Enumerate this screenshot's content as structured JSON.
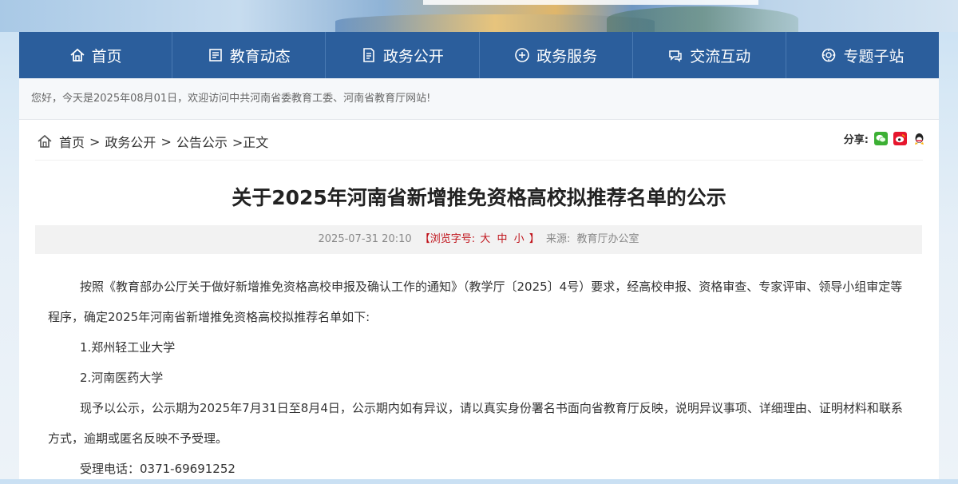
{
  "nav": {
    "items": [
      {
        "label": "首页",
        "icon": "home-icon"
      },
      {
        "label": "教育动态",
        "icon": "news-icon"
      },
      {
        "label": "政务公开",
        "icon": "document-icon"
      },
      {
        "label": "政务服务",
        "icon": "service-icon"
      },
      {
        "label": "交流互动",
        "icon": "interaction-icon"
      },
      {
        "label": "专题子站",
        "icon": "topic-icon"
      }
    ]
  },
  "welcome": {
    "text": "您好，今天是2025年08月01日，欢迎访问中共河南省委教育工委、河南省教育厅网站!"
  },
  "breadcrumb": {
    "home": "首页",
    "sep1": ">",
    "level1": "政务公开",
    "sep2": ">",
    "level2": "公告公示",
    "current": ">正文"
  },
  "share": {
    "label": "分享:",
    "targets": [
      "wechat-icon",
      "weibo-icon",
      "qq-icon"
    ]
  },
  "article": {
    "title": "关于2025年河南省新增推免资格高校拟推荐名单的公示",
    "meta": {
      "datetime": "2025-07-31 20:10",
      "font_size_prefix": "【浏览字号:",
      "font_large": "大",
      "font_medium": "中",
      "font_small": "小",
      "font_size_suffix": "】",
      "source_label": "来源:",
      "source": "教育厅办公室"
    },
    "paragraphs": [
      "按照《教育部办公厅关于做好新增推免资格高校申报及确认工作的通知》（教学厅〔2025〕4号）要求，经高校申报、资格审查、专家评审、领导小组审定等程序，确定2025年河南省新增推免资格高校拟推荐名单如下:",
      "1.郑州轻工业大学",
      "2.河南医药大学",
      "现予以公示，公示期为2025年7月31日至8月4日，公示期内如有异议，请以真实身份署名书面向省教育厅反映，说明异议事项、详细理由、证明材料和联系方式，逾期或匿名反映不予受理。",
      "受理电话：0371-69691252"
    ]
  },
  "colors": {
    "nav_bg": "#2b5e9c",
    "accent_red": "#c0141c"
  }
}
